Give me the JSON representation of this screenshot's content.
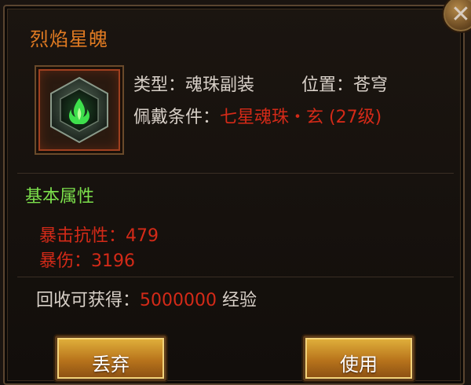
{
  "item": {
    "name": "烈焰星魄",
    "icon": "green-flame-hexagon-gem-icon",
    "type_label": "类型：",
    "type_value": "魂珠副装",
    "position_label": "位置：",
    "position_value": "苍穹",
    "requirement_label": "佩戴条件：",
    "requirement_value": "七星魂珠・玄 (27级)"
  },
  "attributes": {
    "title": "基本属性",
    "stats": [
      {
        "label": "暴击抗性：",
        "value": "479"
      },
      {
        "label": "暴伤：",
        "value": "3196"
      }
    ]
  },
  "recycle": {
    "label": "回收可获得：",
    "amount": "5000000",
    "unit": "经验"
  },
  "buttons": {
    "discard": "丢弃",
    "use": "使用",
    "close": "✕"
  },
  "colors": {
    "title": "#e07a22",
    "highlight_red": "#d42a18",
    "section_green": "#7ce04c",
    "text": "#d8d0c8"
  }
}
